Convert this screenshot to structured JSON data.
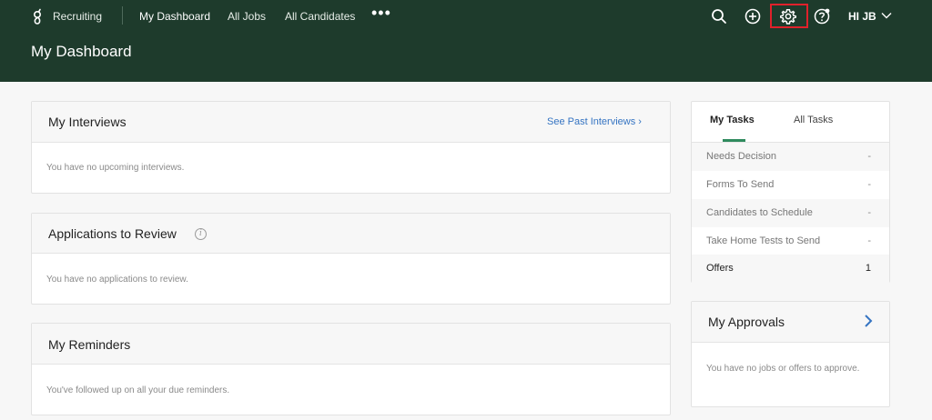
{
  "nav": {
    "brand": "Recruiting",
    "links": [
      "My Dashboard",
      "All Jobs",
      "All Candidates"
    ],
    "more": "•••",
    "user": "HI JB"
  },
  "page": {
    "title": "My Dashboard"
  },
  "interviews": {
    "title": "My Interviews",
    "link": "See Past Interviews ›",
    "empty": "You have no upcoming interviews."
  },
  "applications": {
    "title": "Applications to Review",
    "info": "i",
    "empty": "You have no applications to review."
  },
  "reminders": {
    "title": "My Reminders",
    "empty": "You've followed up on all your due reminders."
  },
  "tasks": {
    "tabs": [
      "My Tasks",
      "All Tasks"
    ],
    "rows": [
      {
        "label": "Needs Decision",
        "count": "-"
      },
      {
        "label": "Forms To Send",
        "count": "-"
      },
      {
        "label": "Candidates to Schedule",
        "count": "-"
      },
      {
        "label": "Take Home Tests to Send",
        "count": "-"
      },
      {
        "label": "Offers",
        "count": "1"
      }
    ]
  },
  "approvals": {
    "title": "My Approvals",
    "empty": "You have no jobs or offers to approve."
  },
  "colors": {
    "header": "#1e3b2c",
    "accent": "#2f8a5e",
    "link": "#3574c2",
    "highlight": "#e0212b"
  }
}
